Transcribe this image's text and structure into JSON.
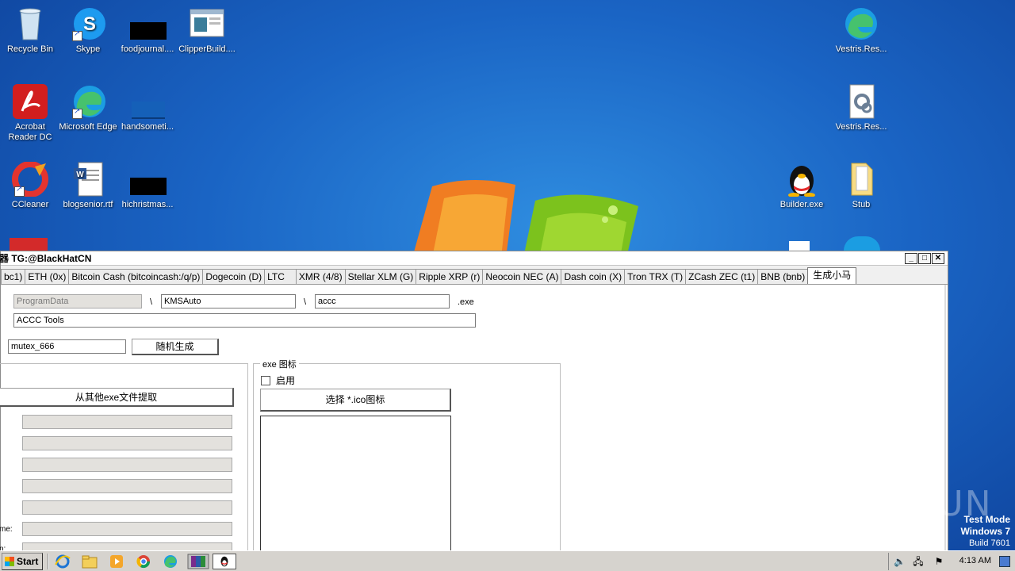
{
  "desktop": {
    "icons": [
      {
        "label": "Recycle Bin"
      },
      {
        "label": "Skype"
      },
      {
        "label": "foodjournal...."
      },
      {
        "label": "ClipperBuild...."
      },
      {
        "label": "Acrobat Reader DC"
      },
      {
        "label": "Microsoft Edge"
      },
      {
        "label": "handsometi..."
      },
      {
        "label": "CCleaner"
      },
      {
        "label": "blogsenior.rtf"
      },
      {
        "label": "hichristmas..."
      },
      {
        "label": "Vestris.Res..."
      },
      {
        "label": "Vestris.Res..."
      },
      {
        "label": "Builder.exe"
      },
      {
        "label": "Stub"
      }
    ]
  },
  "window": {
    "title": "器 TG:@BlackHatCN",
    "buttons": {
      "minimize": "_",
      "maximize": "□",
      "close": "✕"
    },
    "tabs": [
      {
        "label": "bc1)"
      },
      {
        "label": "ETH (0x)"
      },
      {
        "label": "Bitcoin Cash (bitcoincash:/q/p)"
      },
      {
        "label": "Dogecoin (D)"
      },
      {
        "label": "LTC"
      },
      {
        "label": "XMR (4/8)"
      },
      {
        "label": "Stellar XLM (G)"
      },
      {
        "label": "Ripple XRP (r)"
      },
      {
        "label": "Neocoin NEC (A)"
      },
      {
        "label": "Dash coin (X)"
      },
      {
        "label": "Tron TRX (T)"
      },
      {
        "label": "ZCash ZEC (t1)"
      },
      {
        "label": "BNB (bnb)"
      },
      {
        "label": "生成小马"
      }
    ],
    "form": {
      "path_root": "ProgramData",
      "sep1": "\\",
      "folder": "KMSAuto",
      "sep2": "\\",
      "exe_name": "accc",
      "ext": ".exe",
      "description": "ACCC Tools",
      "mutex": "mutex_666",
      "random_button": "随机生成",
      "extract_button": "从其他exe文件提取",
      "partial_label_1": "me:",
      "partial_label_2": "n:",
      "icon_group_title": "exe 图标",
      "enable_label": "启用",
      "choose_ico_button": "选择 *.ico图标"
    }
  },
  "watermark": "ANY RUN",
  "test_mode": {
    "line1": "Test Mode",
    "line2": "Windows 7",
    "line3": "Build 7601"
  },
  "taskbar": {
    "start_label": "Start",
    "clock": "4:13 AM"
  }
}
